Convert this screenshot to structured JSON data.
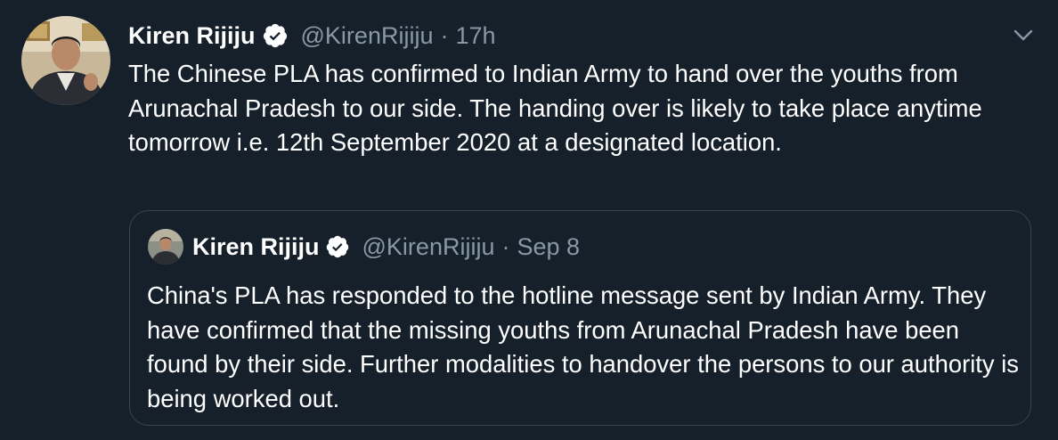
{
  "tweet": {
    "author_name": "Kiren Rijiju",
    "handle": "@KirenRijiju",
    "separator": "·",
    "time": "17h",
    "text": "The Chinese PLA has confirmed to Indian Army to hand over the youths from Arunachal Pradesh to our side. The handing over is likely to take place anytime tomorrow i.e. 12th September 2020 at a designated location.",
    "avatar_icon": "user-avatar",
    "verified_icon": "verified-badge-icon",
    "menu_icon": "chevron-down-icon"
  },
  "quoted_tweet": {
    "author_name": "Kiren Rijiju",
    "handle": "@KirenRijiju",
    "separator": "·",
    "time": "Sep 8",
    "text": "China's PLA has responded to the hotline message sent by Indian Army. They have confirmed that the missing youths from Arunachal Pradesh have been found by their side. Further modalities to handover the persons to our authority is being worked out.",
    "avatar_icon": "user-avatar",
    "verified_icon": "verified-badge-icon"
  },
  "colors": {
    "background": "#15202b",
    "text_primary": "#ffffff",
    "text_secondary": "#8899a6",
    "border": "#38444d"
  }
}
